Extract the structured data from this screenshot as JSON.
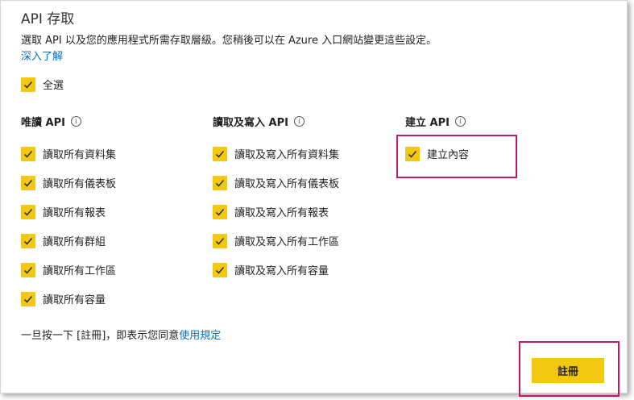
{
  "header": {
    "title": "API 存取",
    "description": "選取 API 以及您的應用程式所需存取層級。您稍後可以在 Azure 入口網站變更這些設定。",
    "learn_more": "深入了解"
  },
  "select_all": {
    "label": "全選",
    "checked": true
  },
  "columns": [
    {
      "heading": "唯讀 API",
      "items": [
        {
          "label": "讀取所有資料集",
          "checked": true
        },
        {
          "label": "讀取所有儀表板",
          "checked": true
        },
        {
          "label": "讀取所有報表",
          "checked": true
        },
        {
          "label": "讀取所有群組",
          "checked": true
        },
        {
          "label": "讀取所有工作區",
          "checked": true
        },
        {
          "label": "讀取所有容量",
          "checked": true
        }
      ]
    },
    {
      "heading": "讀取及寫入 API",
      "items": [
        {
          "label": "讀取及寫入所有資料集",
          "checked": true
        },
        {
          "label": "讀取及寫入所有儀表板",
          "checked": true
        },
        {
          "label": "讀取及寫入所有報表",
          "checked": true
        },
        {
          "label": "讀取及寫入所有工作區",
          "checked": true
        },
        {
          "label": "讀取及寫入所有容量",
          "checked": true
        }
      ]
    },
    {
      "heading": "建立 API",
      "items": [
        {
          "label": "建立內容",
          "checked": true
        }
      ]
    }
  ],
  "footer": {
    "text": "一旦按一下 [註冊]，即表示您同意",
    "link": "使用規定"
  },
  "register_button": "註冊",
  "colors": {
    "accent": "#f2c811",
    "highlight": "#c0196b",
    "link": "#0b6fb8"
  }
}
